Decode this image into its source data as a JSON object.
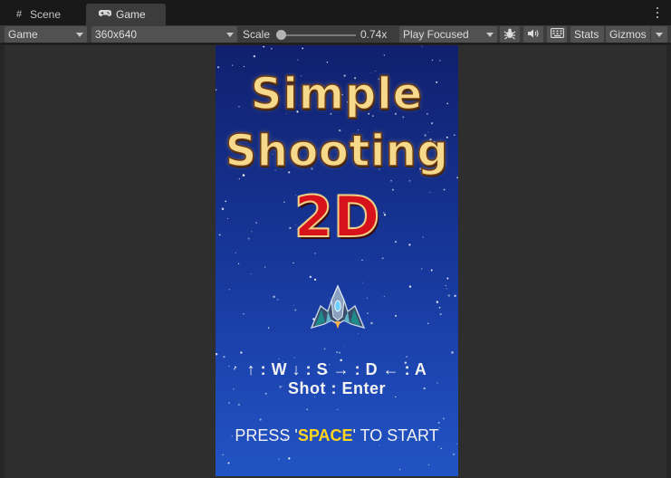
{
  "tabs": [
    {
      "label": "Scene",
      "icon": "grid-icon",
      "active": false
    },
    {
      "label": "Game",
      "icon": "gamepad-icon",
      "active": true
    }
  ],
  "toolbar": {
    "display_select": "Game",
    "resolution_select": "360x640",
    "scale_label": "Scale",
    "scale_value": "0.74x",
    "scale_fraction": 0.0,
    "play_mode_select": "Play Focused",
    "stats_label": "Stats",
    "gizmos_label": "Gizmos"
  },
  "game": {
    "title_line1": "Simple",
    "title_line2": "Shooting",
    "title_line3": "2D",
    "controls": "↑ : W ↓ : S → : D ← : A",
    "shot": "Shot : Enter",
    "press_prefix": "PRESS '",
    "press_key": "SPACE",
    "press_suffix": "' TO START"
  },
  "colors": {
    "editor_bg": "#2e2e2e",
    "toolbar_bg": "#3c3c3c",
    "title_gold": "#f6d98a",
    "title_red": "#d7121a",
    "key_yellow": "#ffd61e",
    "sky_top": "#10206e",
    "sky_bottom": "#2254c4"
  }
}
